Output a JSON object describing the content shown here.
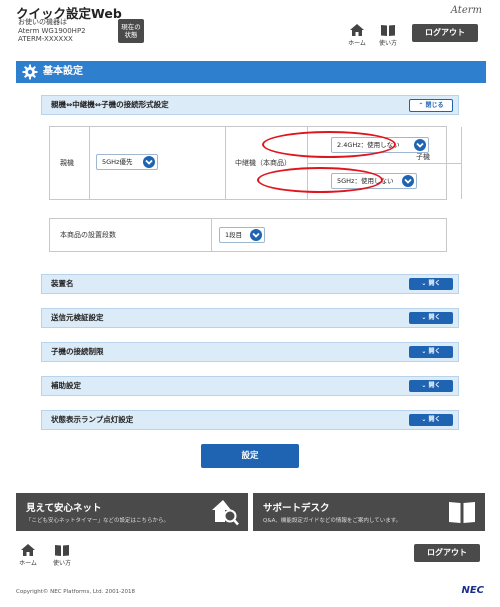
{
  "header": {
    "app_title": "クイック設定Web",
    "device_line1": "お使いの機器は",
    "device_line2": "Aterm WG1900HP2",
    "device_line3": "ATERM-XXXXXX",
    "status_line1": "現在の",
    "status_line2": "状態",
    "brand": "Aterm",
    "nav_home": "ホーム",
    "nav_manual": "使い方",
    "logout": "ログアウト"
  },
  "section": {
    "title": "基本設定"
  },
  "connection": {
    "header": "親機⇔中継機⇔子機の接続形式設定",
    "close_label": "閉じる",
    "parent_label": "親機",
    "parent_value": "5GHz優先",
    "repeater_label": "中継機（本商品）",
    "repeater_24_value": "2.4GHz：使用しない",
    "repeater_5_value": "5GHz：使用しない",
    "child_label": "子機"
  },
  "stage": {
    "label": "本商品の設置段数",
    "value": "1段目"
  },
  "accordions": [
    {
      "title": "装置名",
      "open_label": "開く"
    },
    {
      "title": "送信元検証設定",
      "open_label": "開く"
    },
    {
      "title": "子機の接続制限",
      "open_label": "開く"
    },
    {
      "title": "補助設定",
      "open_label": "開く"
    },
    {
      "title": "状態表示ランプ点灯設定",
      "open_label": "開く"
    }
  ],
  "apply_label": "設定",
  "promos": {
    "left_title": "見えて安心ネット",
    "left_desc": "「こども安心ネットタイマー」などの設定はこちらから。",
    "right_title": "サポートデスク",
    "right_desc": "Q&A、機能設定ガイドなどの情報をご案内しています。"
  },
  "footer": {
    "nav_home": "ホーム",
    "nav_manual": "使い方",
    "logout": "ログアウト",
    "copyright": "Copyright© NEC Platforms, Ltd. 2001-2018",
    "logo": "NEC"
  },
  "colors": {
    "accent_blue": "#2f7fcf",
    "button_blue": "#1f63b3",
    "accordion_bg": "#dcebf8",
    "dark_button": "#4a4a4a",
    "highlight_red": "#e0161e"
  }
}
